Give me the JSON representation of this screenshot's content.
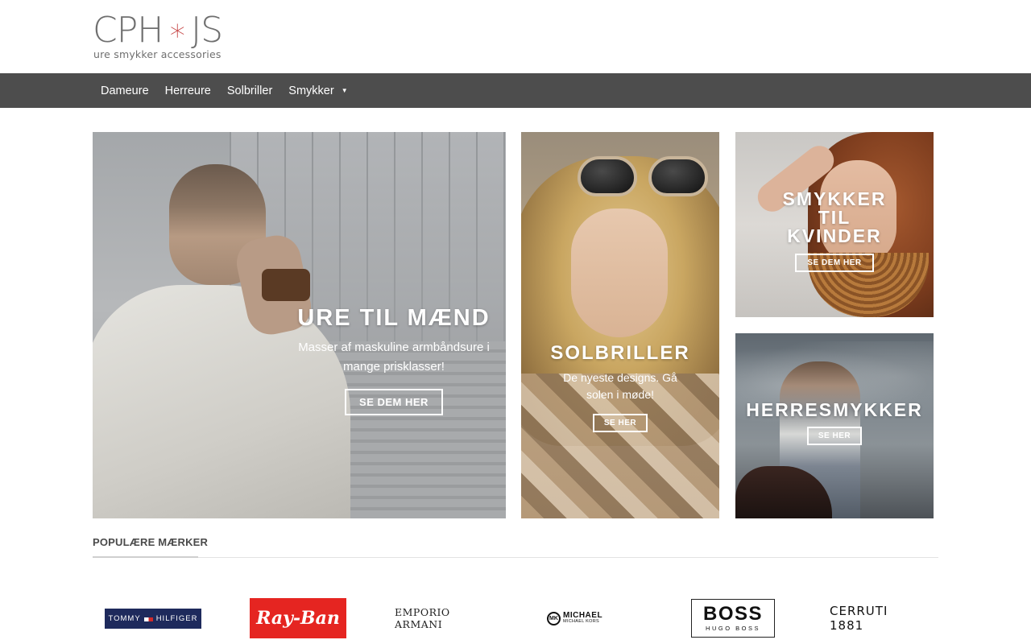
{
  "header": {
    "logo_main_left": "CPH",
    "logo_star": "∗",
    "logo_main_right": "JS",
    "logo_sub": "ure  smykker  accessories"
  },
  "nav": {
    "items": [
      {
        "label": "Dameure"
      },
      {
        "label": "Herreure"
      },
      {
        "label": "Solbriller"
      },
      {
        "label": "Smykker",
        "has_dropdown": true
      }
    ],
    "caret": "▼"
  },
  "banners": [
    {
      "title": "URE TIL MÆND",
      "subtitle": "Masser af maskuline armbåndsure i mange prisklasser!",
      "button": "SE DEM HER"
    },
    {
      "title": "SOLBRILLER",
      "subtitle": "De nyeste designs. Gå solen i møde!",
      "button": "SE HER"
    },
    {
      "title_lines": [
        "SMYKKER",
        "TIL",
        "KVINDER"
      ],
      "button": "SE DEM HER"
    },
    {
      "title": "HERRESMYKKER",
      "button": "SE HER"
    }
  ],
  "brands_section": {
    "title": "POPULÆRE MÆRKER",
    "brands": {
      "tommy_left": "TOMMY",
      "tommy_right": "HILFIGER",
      "rayban": "Ray-Ban",
      "armani": "EMPORIO ARMANI",
      "mk_badge": "MK",
      "mk_line1": "MICHAEL",
      "mk_line2": "MICHAEL KORS",
      "boss_main": "BOSS",
      "boss_sub": "HUGO BOSS",
      "cerruti": "CERRUTI 1881"
    }
  },
  "colors": {
    "nav_bg": "#4d4d4d",
    "logo_star": "#c74a4a",
    "rayban_red": "#e52521",
    "tommy_navy": "#1e2a5c"
  }
}
